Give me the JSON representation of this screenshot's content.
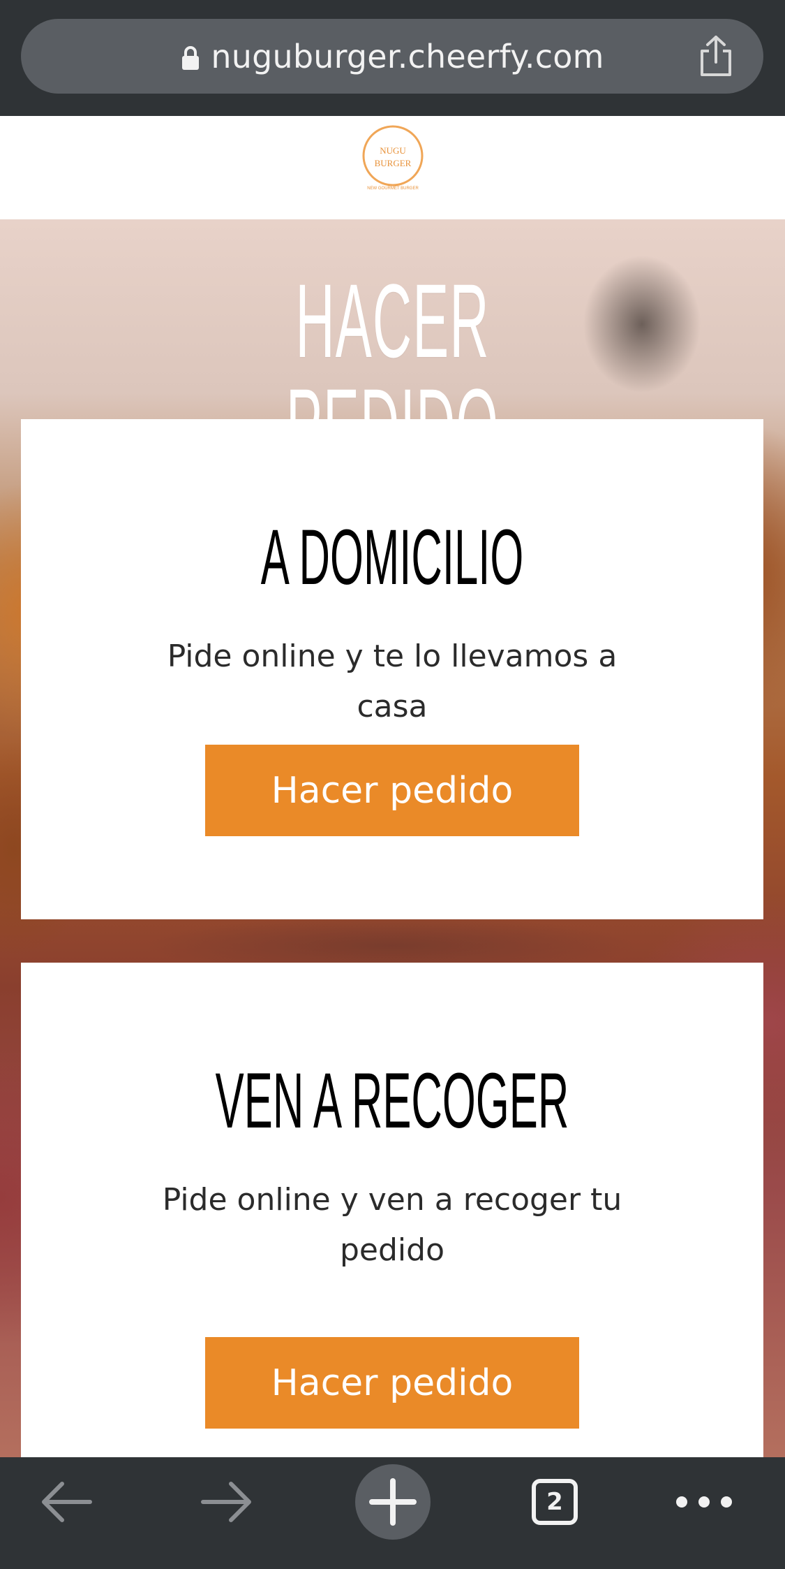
{
  "browser": {
    "url": "nuguburger.cheerfy.com",
    "tab_count": "2"
  },
  "site": {
    "logo_text_line1": "NUGU",
    "logo_text_line2": "BURGER",
    "logo_tagline": "NEW GOURMET BURGER"
  },
  "hero": {
    "title": "HACER PEDIDO"
  },
  "cards": [
    {
      "title": "A DOMICILIO",
      "description": "Pide online y te lo llevamos a casa",
      "button_label": "Hacer pedido"
    },
    {
      "title": "VEN A RECOGER",
      "description": "Pide online y ven a recoger tu pedido",
      "button_label": "Hacer pedido"
    }
  ],
  "colors": {
    "accent": "#ea8a28",
    "browser_chrome": "#2f3336",
    "url_pill": "#5a5e63"
  },
  "icons": {
    "lock": "lock-icon",
    "share": "share-icon",
    "back": "back-arrow-icon",
    "forward": "forward-arrow-icon",
    "new_tab": "plus-icon",
    "tabs": "tabs-icon",
    "more": "more-icon"
  }
}
